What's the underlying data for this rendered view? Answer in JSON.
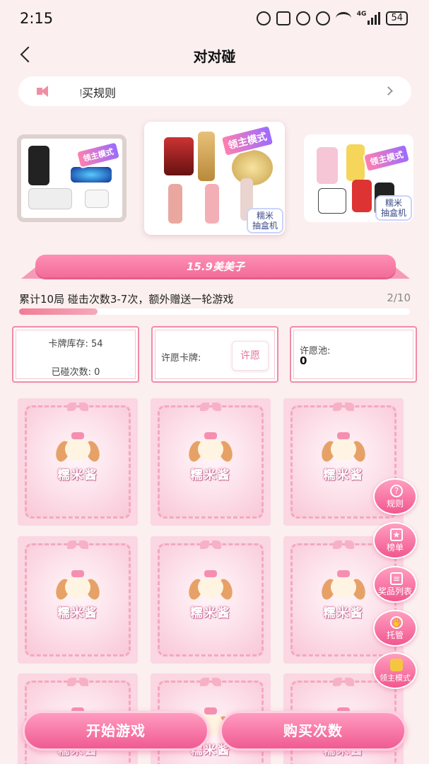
{
  "status_bar": {
    "time": "2:15",
    "network": "4G",
    "battery": "54",
    "icons": [
      "eye-icon",
      "nfc-icon",
      "alarm-icon",
      "mute-icon",
      "wifi-icon",
      "signal-icon",
      "battery-icon"
    ]
  },
  "header": {
    "title": "对对碰",
    "back_icon": "chevron-left-icon"
  },
  "notice": {
    "icon": "megaphone-icon",
    "text": "购买规则",
    "visible_text": "购买规则"
  },
  "prizes": [
    {
      "mode_badge": "领主模式",
      "box_label": ""
    },
    {
      "mode_badge": "领主模式",
      "box_label": "糯米\n抽盒机"
    },
    {
      "mode_badge": "领主模式",
      "box_label": "糯米\n抽盒机"
    }
  ],
  "banner": {
    "title": "15.9美美子"
  },
  "progress": {
    "description": "累计10局 碰击次数3-7次，额外赠送一轮游戏",
    "count_text": "2/10",
    "value": 0.2
  },
  "info": {
    "stock_label": "卡牌库存: 54",
    "touched_label": "已碰次数: 0",
    "wish_card_label": "许愿卡牌:",
    "wish_button": "许愿",
    "wish_pool_label": "许愿池:",
    "wish_pool_value": "0"
  },
  "cards": {
    "name": "糯米酱",
    "count_visible": 9
  },
  "side_menu": [
    {
      "icon": "question-icon",
      "label": "规则"
    },
    {
      "icon": "ranking-icon",
      "label": "榜单"
    },
    {
      "icon": "list-icon",
      "label": "奖品列表"
    },
    {
      "icon": "handshake-icon",
      "label": "托管"
    },
    {
      "icon": "crown-icon",
      "label": "领主模式"
    }
  ],
  "buttons": {
    "start": "开始游戏",
    "buy": "购买次数"
  },
  "colors": {
    "background": "#fbefef",
    "accent_pink": "#f05a92",
    "wish_text": "#e9729b"
  }
}
